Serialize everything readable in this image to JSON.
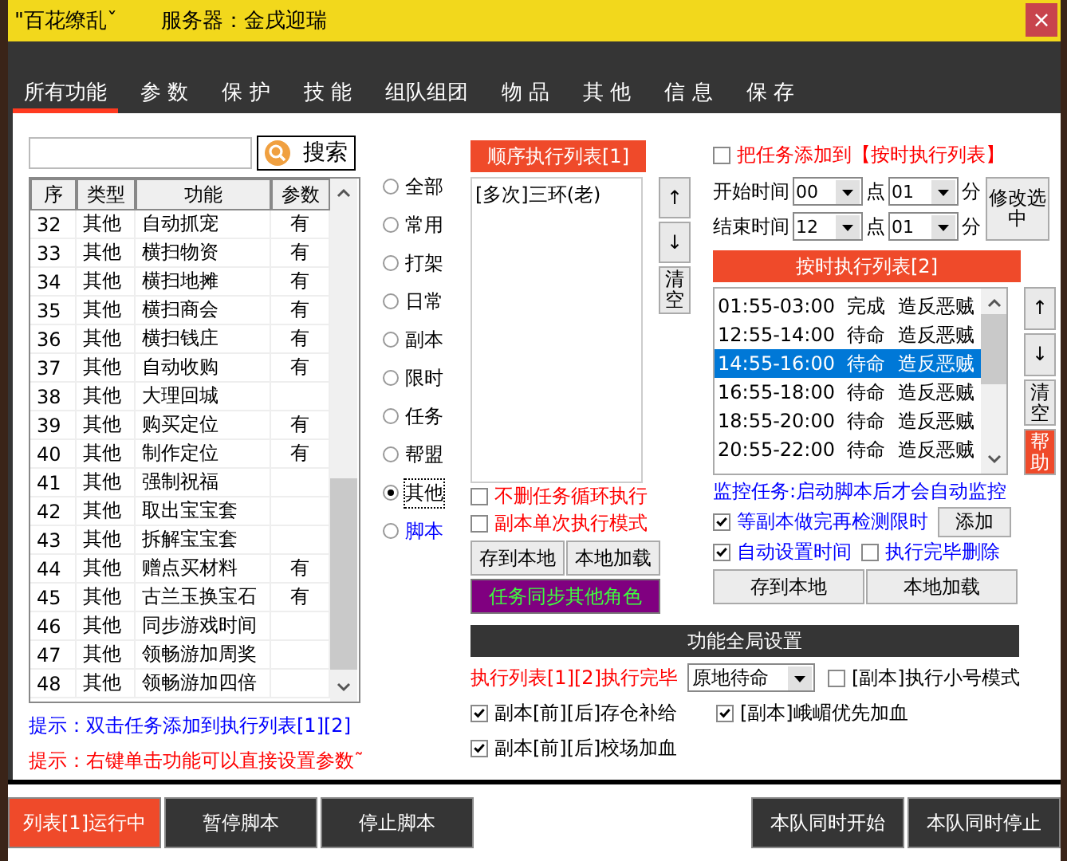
{
  "title_bar": {
    "title": "\"百花缭乱ˇ",
    "server": "服务器：金戌迎瑞",
    "close": "×"
  },
  "tabs": [
    {
      "label": "所有功能",
      "selected": true
    },
    {
      "label": "参 数",
      "selected": false
    },
    {
      "label": "保 护",
      "selected": false
    },
    {
      "label": "技 能",
      "selected": false
    },
    {
      "label": "组队组团",
      "selected": false
    },
    {
      "label": "物 品",
      "selected": false
    },
    {
      "label": "其 他",
      "selected": false
    },
    {
      "label": "信 息",
      "selected": false
    },
    {
      "label": "保 存",
      "selected": false
    }
  ],
  "search": {
    "button": "搜索"
  },
  "table": {
    "columns": [
      "序",
      "类型",
      "功能",
      "参数"
    ],
    "rows": [
      {
        "no": "32",
        "type": "其他",
        "name": "自动抓宠",
        "param": "有"
      },
      {
        "no": "33",
        "type": "其他",
        "name": "横扫物资",
        "param": "有"
      },
      {
        "no": "34",
        "type": "其他",
        "name": "横扫地摊",
        "param": "有"
      },
      {
        "no": "35",
        "type": "其他",
        "name": "横扫商会",
        "param": "有"
      },
      {
        "no": "36",
        "type": "其他",
        "name": "横扫钱庄",
        "param": "有"
      },
      {
        "no": "37",
        "type": "其他",
        "name": "自动收购",
        "param": "有"
      },
      {
        "no": "38",
        "type": "其他",
        "name": "大理回城"
      },
      {
        "no": "39",
        "type": "其他",
        "name": "购买定位",
        "param": "有"
      },
      {
        "no": "40",
        "type": "其他",
        "name": "制作定位",
        "param": "有"
      },
      {
        "no": "41",
        "type": "其他",
        "name": "强制祝福"
      },
      {
        "no": "42",
        "type": "其他",
        "name": "取出宝宝套"
      },
      {
        "no": "43",
        "type": "其他",
        "name": "拆解宝宝套"
      },
      {
        "no": "44",
        "type": "其他",
        "name": "赠点买材料",
        "param": "有"
      },
      {
        "no": "45",
        "type": "其他",
        "name": "古兰玉换宝石",
        "param": "有"
      },
      {
        "no": "46",
        "type": "其他",
        "name": "同步游戏时间"
      },
      {
        "no": "47",
        "type": "其他",
        "name": "领畅游加周奖"
      },
      {
        "no": "48",
        "type": "其他",
        "name": "领畅游加四倍"
      }
    ]
  },
  "categories": [
    {
      "label": "全部",
      "selected": false,
      "color": "#000000"
    },
    {
      "label": "常用",
      "selected": false,
      "color": "#000000"
    },
    {
      "label": "打架",
      "selected": false,
      "color": "#000000"
    },
    {
      "label": "日常",
      "selected": false,
      "color": "#000000"
    },
    {
      "label": "副本",
      "selected": false,
      "color": "#000000"
    },
    {
      "label": "限时",
      "selected": false,
      "color": "#000000"
    },
    {
      "label": "任务",
      "selected": false,
      "color": "#000000"
    },
    {
      "label": "帮盟",
      "selected": false,
      "color": "#000000"
    },
    {
      "label": "其他",
      "selected": true,
      "color": "#000000"
    },
    {
      "label": "脚本",
      "selected": false,
      "color": "#0000ff"
    }
  ],
  "hints": [
    {
      "text": "提示：双击任务添加到执行列表[1][2]",
      "color": "#0000ff"
    },
    {
      "text": "提示：右键单击功能可以直接设置参数˜",
      "color": "#ff0000"
    }
  ],
  "sequence": {
    "title": "顺序执行列表[1]",
    "items": [
      "[多次]三环(老)"
    ],
    "side_buttons": [
      "↑",
      "↓",
      "清空"
    ],
    "options": [
      {
        "label": "不删任务循环执行",
        "checked": false
      },
      {
        "label": "副本单次执行模式",
        "checked": false
      }
    ],
    "buttons": [
      "存到本地",
      "本地加载"
    ],
    "sync_button": "任务同步其他角色"
  },
  "timed": {
    "add_option": {
      "label": "把任务添加到【按时执行列表】",
      "checked": false
    },
    "start": {
      "label": "开始时间",
      "hour": "00",
      "hour_unit": "点",
      "minute": "01",
      "minute_unit": "分"
    },
    "end": {
      "label": "结束时间",
      "hour": "12",
      "hour_unit": "点",
      "minute": "01",
      "minute_unit": "分"
    },
    "modify_button": "修改选中",
    "title": "按时执行列表[2]",
    "rows": [
      {
        "time": "01:55-03:00",
        "status": "完成",
        "task": "造反恶贼",
        "selected": false
      },
      {
        "time": "12:55-14:00",
        "status": "待命",
        "task": "造反恶贼",
        "selected": false
      },
      {
        "time": "14:55-16:00",
        "status": "待命",
        "task": "造反恶贼",
        "selected": true
      },
      {
        "time": "16:55-18:00",
        "status": "待命",
        "task": "造反恶贼",
        "selected": false
      },
      {
        "time": "18:55-20:00",
        "status": "待命",
        "task": "造反恶贼",
        "selected": false
      },
      {
        "time": "20:55-22:00",
        "status": "待命",
        "task": "造反恶贼",
        "selected": false
      }
    ],
    "side_buttons": [
      {
        "label": "↑",
        "kind": "normal"
      },
      {
        "label": "↓",
        "kind": "normal"
      },
      {
        "label": "清空",
        "kind": "normal"
      },
      {
        "label": "帮助",
        "kind": "help"
      }
    ],
    "monitor_note": "监控任务:启动脚本后才会自动监控",
    "wait_option": {
      "label": "等副本做完再检测限时",
      "checked": true
    },
    "add_button": "添加",
    "auto_time_option": {
      "label": "自动设置时间",
      "checked": true
    },
    "delete_option": {
      "label": "执行完毕删除",
      "checked": false
    },
    "buttons": [
      "存到本地",
      "本地加载"
    ]
  },
  "global": {
    "title": "功能全局设置",
    "finish_label": "执行列表[1][2]执行完毕",
    "finish_value": "原地待命",
    "options": [
      {
        "label": "[副本]执行小号模式",
        "checked": false
      },
      {
        "label": "副本[前][后]存仓补给",
        "checked": true
      },
      {
        "label": "[副本]峨嵋优先加血",
        "checked": true
      },
      {
        "label": "副本[前][后]校场加血",
        "checked": true
      }
    ]
  },
  "bottom_left": [
    {
      "label": "列表[1]运行中",
      "kind": "running"
    },
    {
      "label": "暂停脚本",
      "kind": "normal"
    },
    {
      "label": "停止脚本",
      "kind": "normal"
    }
  ],
  "bottom_right": [
    {
      "label": "本队同时开始",
      "kind": "normal"
    },
    {
      "label": "本队同时停止",
      "kind": "normal"
    }
  ]
}
